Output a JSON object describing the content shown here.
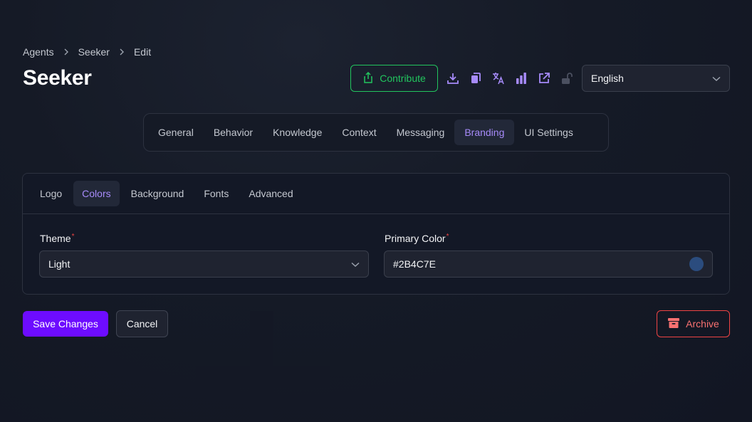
{
  "breadcrumb": [
    "Agents",
    "Seeker",
    "Edit"
  ],
  "page_title": "Seeker",
  "header": {
    "contribute_label": "Contribute",
    "icons": [
      "download-icon",
      "copy-icon",
      "translate-icon",
      "analytics-icon",
      "external-link-icon",
      "unlock-icon"
    ],
    "language": "English"
  },
  "main_tabs": [
    "General",
    "Behavior",
    "Knowledge",
    "Context",
    "Messaging",
    "Branding",
    "UI Settings"
  ],
  "main_tab_active": "Branding",
  "sub_tabs": [
    "Logo",
    "Colors",
    "Background",
    "Fonts",
    "Advanced"
  ],
  "sub_tab_active": "Colors",
  "form": {
    "theme_label": "Theme",
    "theme_value": "Light",
    "primary_color_label": "Primary Color",
    "primary_color_value": "#2B4C7E",
    "required_marker": "*"
  },
  "actions": {
    "save_label": "Save Changes",
    "cancel_label": "Cancel",
    "archive_label": "Archive"
  },
  "colors": {
    "accent": "#a78bfa",
    "contribute": "#22c55e",
    "save": "#6d0cff",
    "archive": "#ef4444",
    "swatch": "#2B4C7E"
  }
}
